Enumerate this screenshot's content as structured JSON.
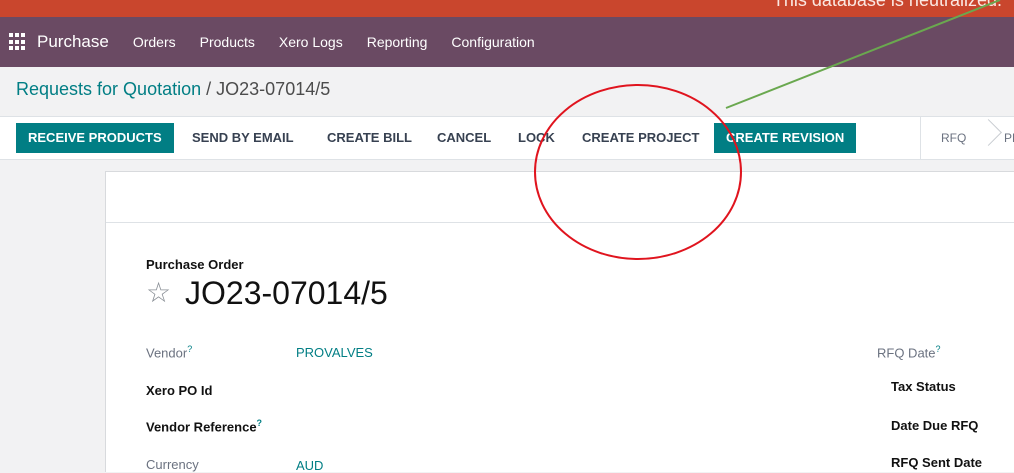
{
  "banner": {
    "text": "This database is neutralized."
  },
  "navbar": {
    "app_name": "Purchase",
    "menu": [
      "Orders",
      "Products",
      "Xero Logs",
      "Reporting",
      "Configuration"
    ]
  },
  "breadcrumb": {
    "parent": "Requests for Quotation",
    "separator": "/",
    "current": "JO23-07014/5"
  },
  "toolbar": {
    "buttons": [
      "RECEIVE PRODUCTS",
      "SEND BY EMAIL",
      "CREATE BILL",
      "CANCEL",
      "LOCK",
      "CREATE PROJECT",
      "CREATE REVISION"
    ],
    "stages": [
      "RFQ",
      "PR"
    ]
  },
  "form": {
    "label": "Purchase Order",
    "title": "JO23-07014/5",
    "left_fields": [
      {
        "label": "Vendor",
        "help": "?",
        "value": "PROVALVES"
      },
      {
        "label": "Xero PO Id",
        "value": ""
      },
      {
        "label": "Vendor Reference",
        "help": "?",
        "value": ""
      },
      {
        "label": "Currency",
        "value": "AUD"
      }
    ],
    "right_fields": [
      {
        "label": "RFQ Date",
        "help": "?"
      },
      {
        "label": "Tax Status"
      },
      {
        "label": "Date Due RFQ"
      },
      {
        "label": "RFQ Sent Date"
      }
    ]
  },
  "colors": {
    "banner": "#c9462d",
    "navbar": "#6a4a63",
    "primary": "#017e84",
    "annotation_circle": "#e0141e",
    "annotation_arrow": "#6aa84f"
  },
  "icons": [
    "apps-grid-icon",
    "star-icon",
    "chevron-right-icon"
  ]
}
